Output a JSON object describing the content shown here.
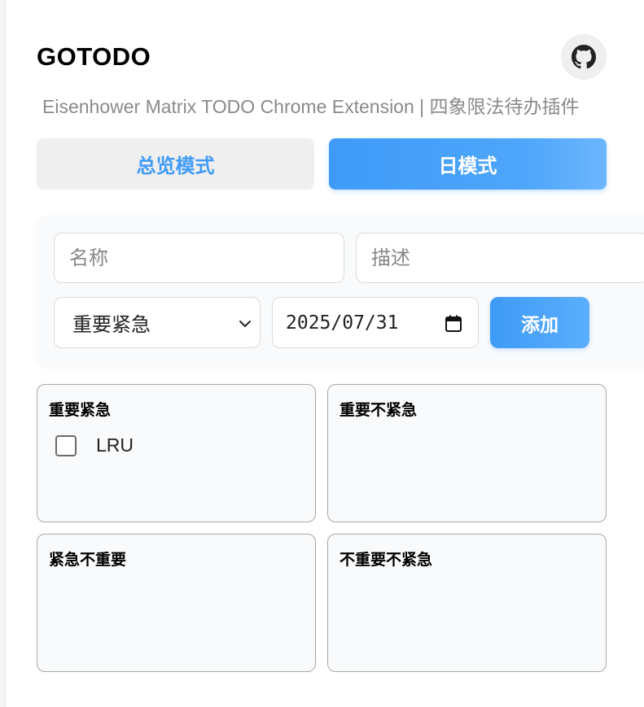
{
  "app": {
    "title": "GOTODO",
    "subtitle": "Eisenhower Matrix TODO Chrome Extension | 四象限法待办插件",
    "github_icon": "github-icon"
  },
  "modes": {
    "overview_label": "总览模式",
    "day_label": "日模式",
    "active": "日模式"
  },
  "form": {
    "name_placeholder": "名称",
    "desc_placeholder": "描述",
    "priority_selected": "重要紧急",
    "date_value": "2025/07/31",
    "add_label": "添加"
  },
  "quadrants": [
    {
      "title": "重要紧急",
      "tasks": [
        {
          "name": "LRU",
          "done": false
        }
      ]
    },
    {
      "title": "重要不紧急",
      "tasks": []
    },
    {
      "title": "紧急不重要",
      "tasks": []
    },
    {
      "title": "不重要不紧急",
      "tasks": []
    }
  ],
  "colors": {
    "accent": "#3f9bf8",
    "tab_inactive_bg": "#efefef",
    "quadrant_bg": "#f9fafb"
  }
}
